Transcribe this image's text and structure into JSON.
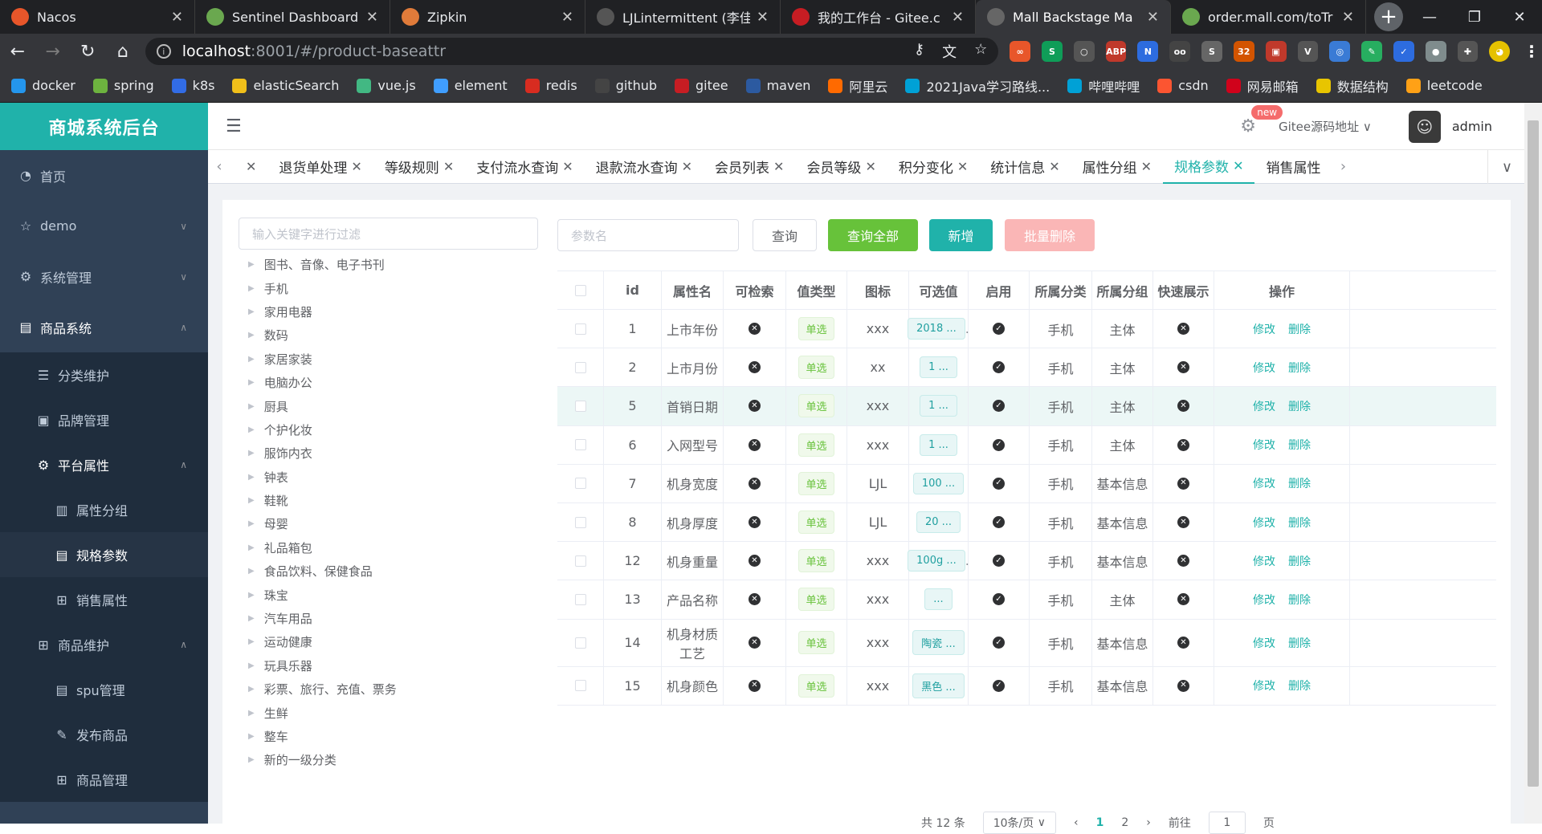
{
  "browser": {
    "tabs": [
      {
        "title": "Nacos",
        "color": "#e8562a"
      },
      {
        "title": "Sentinel Dashboard",
        "color": "#6aa84f"
      },
      {
        "title": "Zipkin",
        "color": "#e07b3a"
      },
      {
        "title": "LJLintermittent (李佳",
        "color": "#555555"
      },
      {
        "title": "我的工作台 - Gitee.c",
        "color": "#c71d23"
      },
      {
        "title": "Mall Backstage Ma",
        "color": "#666666",
        "active": true
      },
      {
        "title": "order.mall.com/toTr",
        "color": "#6aa84f"
      }
    ],
    "url_host": "localhost",
    "url_path": ":8001/#/product-baseattr",
    "bookmarks": [
      {
        "label": "docker",
        "color": "#2496ed"
      },
      {
        "label": "spring",
        "color": "#6db33f"
      },
      {
        "label": "k8s",
        "color": "#326ce5"
      },
      {
        "label": "elasticSearch",
        "color": "#f0bf1a"
      },
      {
        "label": "vue.js",
        "color": "#42b883"
      },
      {
        "label": "element",
        "color": "#409eff"
      },
      {
        "label": "redis",
        "color": "#d82c20"
      },
      {
        "label": "github",
        "color": "#444444"
      },
      {
        "label": "gitee",
        "color": "#c71d23"
      },
      {
        "label": "maven",
        "color": "#2c5aa0"
      },
      {
        "label": "阿里云",
        "color": "#ff6a00"
      },
      {
        "label": "2021Java学习路线...",
        "color": "#00a1d6"
      },
      {
        "label": "哔哩哔哩",
        "color": "#00a1d6"
      },
      {
        "label": "csdn",
        "color": "#fc5531"
      },
      {
        "label": "网易邮箱",
        "color": "#d0021b"
      },
      {
        "label": "数据结构",
        "color": "#e8c500"
      },
      {
        "label": "leetcode",
        "color": "#ffa116"
      }
    ]
  },
  "app": {
    "brand": "商城系统后台",
    "accent": "#20b2aa",
    "user": "admin",
    "gitee_link": "Gitee源码地址",
    "new_badge": "new"
  },
  "menu": {
    "home": "首页",
    "demo": "demo",
    "system": "系统管理",
    "product": "商品系统",
    "category": "分类维护",
    "brand": "品牌管理",
    "platform_attr": "平台属性",
    "attr_group": "属性分组",
    "spec_param": "规格参数",
    "sale_attr": "销售属性",
    "product_maint": "商品维护",
    "spu": "spu管理",
    "publish": "发布商品",
    "goods": "商品管理"
  },
  "tags": [
    "退货单处理",
    "等级规则",
    "支付流水查询",
    "退款流水查询",
    "会员列表",
    "会员等级",
    "积分变化",
    "统计信息",
    "属性分组",
    "规格参数",
    "销售属性"
  ],
  "active_tag": "规格参数",
  "tree": {
    "filter_placeholder": "输入关键字进行过滤",
    "nodes": [
      "图书、音像、电子书刊",
      "手机",
      "家用电器",
      "数码",
      "家居家装",
      "电脑办公",
      "厨具",
      "个护化妆",
      "服饰内衣",
      "钟表",
      "鞋靴",
      "母婴",
      "礼品箱包",
      "食品饮料、保健食品",
      "珠宝",
      "汽车用品",
      "运动健康",
      "玩具乐器",
      "彩票、旅行、充值、票务",
      "生鲜",
      "整车",
      "新的一级分类"
    ]
  },
  "toolbar": {
    "param_placeholder": "参数名",
    "query": "查询",
    "query_all": "查询全部",
    "add": "新增",
    "batch_delete": "批量删除"
  },
  "table": {
    "headers": [
      "id",
      "属性名",
      "可检索",
      "值类型",
      "图标",
      "可选值",
      "启用",
      "所属分类",
      "所属分组",
      "快速展示",
      "操作"
    ],
    "edit": "修改",
    "delete": "删除",
    "rows": [
      {
        "id": "1",
        "name": "上市年份",
        "searchable": false,
        "type": "单选",
        "icon": "xxx",
        "values": "2018 ...",
        "more": true,
        "enabled": true,
        "category": "手机",
        "group": "主体",
        "quick": false
      },
      {
        "id": "2",
        "name": "上市月份",
        "searchable": false,
        "type": "单选",
        "icon": "xx",
        "values": "1 ...",
        "more": false,
        "enabled": true,
        "category": "手机",
        "group": "主体",
        "quick": false
      },
      {
        "id": "5",
        "name": "首销日期",
        "searchable": false,
        "type": "单选",
        "icon": "xxx",
        "values": "1 ...",
        "more": false,
        "enabled": true,
        "category": "手机",
        "group": "主体",
        "quick": false,
        "highlight": true
      },
      {
        "id": "6",
        "name": "入网型号",
        "searchable": false,
        "type": "单选",
        "icon": "xxx",
        "values": "1 ...",
        "more": false,
        "enabled": true,
        "category": "手机",
        "group": "主体",
        "quick": false
      },
      {
        "id": "7",
        "name": "机身宽度",
        "searchable": false,
        "type": "单选",
        "icon": "LJL",
        "values": "100 ...",
        "more": false,
        "enabled": true,
        "category": "手机",
        "group": "基本信息",
        "quick": false
      },
      {
        "id": "8",
        "name": "机身厚度",
        "searchable": false,
        "type": "单选",
        "icon": "LJL",
        "values": "20 ...",
        "more": false,
        "enabled": true,
        "category": "手机",
        "group": "基本信息",
        "quick": false
      },
      {
        "id": "12",
        "name": "机身重量",
        "searchable": false,
        "type": "单选",
        "icon": "xxx",
        "values": "100g ...",
        "more": true,
        "enabled": true,
        "category": "手机",
        "group": "基本信息",
        "quick": false
      },
      {
        "id": "13",
        "name": "产品名称",
        "searchable": false,
        "type": "单选",
        "icon": "xxx",
        "values": "...",
        "more": false,
        "enabled": true,
        "category": "手机",
        "group": "主体",
        "quick": false
      },
      {
        "id": "14",
        "name": "机身材质工艺",
        "searchable": false,
        "type": "单选",
        "icon": "xxx",
        "values": "陶瓷 ...",
        "more": false,
        "enabled": true,
        "category": "手机",
        "group": "基本信息",
        "quick": false,
        "tall": true
      },
      {
        "id": "15",
        "name": "机身颜色",
        "searchable": false,
        "type": "单选",
        "icon": "xxx",
        "values": "黑色 ...",
        "more": false,
        "enabled": true,
        "category": "手机",
        "group": "基本信息",
        "quick": false
      }
    ]
  },
  "pager": {
    "total": "共 12 条",
    "size": "10条/页",
    "pages": [
      "1",
      "2"
    ],
    "current": "1",
    "goto": "前往",
    "goto_value": "1",
    "page_unit": "页"
  }
}
